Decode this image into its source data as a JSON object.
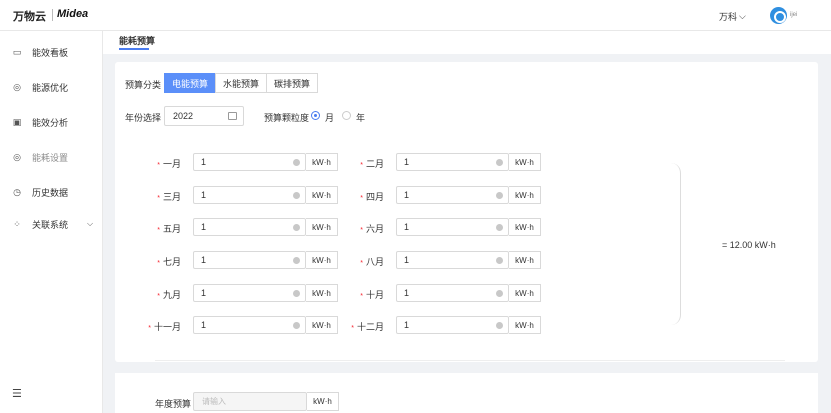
{
  "header": {
    "logo_text": "万物云",
    "partner_logo": "Midea",
    "user_menu": "万科",
    "user_name": "ijei"
  },
  "sidebar": {
    "items": [
      {
        "label": "能效看板",
        "icon": "dashboard-icon"
      },
      {
        "label": "能源优化",
        "icon": "energy-optimize-icon"
      },
      {
        "label": "能效分析",
        "icon": "chart-icon"
      },
      {
        "label": "能耗设置",
        "icon": "settings-icon",
        "active": true
      },
      {
        "label": "历史数据",
        "icon": "history-icon"
      },
      {
        "label": "关联系统",
        "icon": "link-system-icon",
        "expandable": true
      }
    ]
  },
  "page": {
    "tab_title": "能耗预算"
  },
  "form": {
    "category_label": "预算分类",
    "category_tabs": [
      "电能预算",
      "水能预算",
      "碳排预算"
    ],
    "year_label": "年份选择",
    "year_value": "2022",
    "granularity_label": "预算颗粒度",
    "granularity_options": [
      "月",
      "年"
    ],
    "months": [
      {
        "label": "一月",
        "value": "1",
        "unit": "kW·h"
      },
      {
        "label": "二月",
        "value": "1",
        "unit": "kW·h"
      },
      {
        "label": "三月",
        "value": "1",
        "unit": "kW·h"
      },
      {
        "label": "四月",
        "value": "1",
        "unit": "kW·h"
      },
      {
        "label": "五月",
        "value": "1",
        "unit": "kW·h"
      },
      {
        "label": "六月",
        "value": "1",
        "unit": "kW·h"
      },
      {
        "label": "七月",
        "value": "1",
        "unit": "kW·h"
      },
      {
        "label": "八月",
        "value": "1",
        "unit": "kW·h"
      },
      {
        "label": "九月",
        "value": "1",
        "unit": "kW·h"
      },
      {
        "label": "十月",
        "value": "1",
        "unit": "kW·h"
      },
      {
        "label": "十一月",
        "value": "1",
        "unit": "kW·h"
      },
      {
        "label": "十二月",
        "value": "1",
        "unit": "kW·h"
      }
    ],
    "required_mark": "*",
    "total_text": "= 12.00 kW·h",
    "annual_label": "年度预算",
    "annual_placeholder": "请输入",
    "annual_unit": "kW·h"
  },
  "colors": {
    "accent": "#5b8ff9",
    "required": "#f5222d"
  }
}
